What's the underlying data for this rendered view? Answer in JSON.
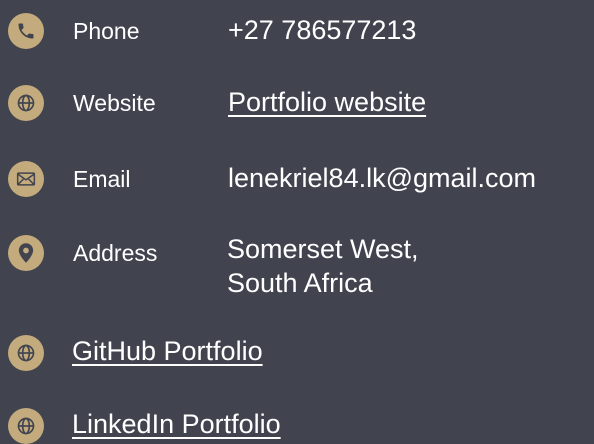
{
  "contact": {
    "phone": {
      "icon": "phone-icon",
      "label": "Phone",
      "value": "+27 786577213"
    },
    "website": {
      "icon": "globe-icon",
      "label": "Website",
      "link_text": "Portfolio website"
    },
    "email": {
      "icon": "envelope-icon",
      "label": "Email",
      "value": "lenekriel84.lk@gmail.com"
    },
    "address": {
      "icon": "map-pin-icon",
      "label": "Address",
      "line1": "Somerset West,",
      "line2": "South Africa"
    },
    "github": {
      "icon": "globe-icon",
      "link_text": "GitHub Portfolio"
    },
    "linkedin": {
      "icon": "globe-icon",
      "link_text": "LinkedIn Portfolio"
    }
  },
  "colors": {
    "background": "#41444f",
    "accent": "#c4ab7d",
    "text": "#ffffff"
  }
}
